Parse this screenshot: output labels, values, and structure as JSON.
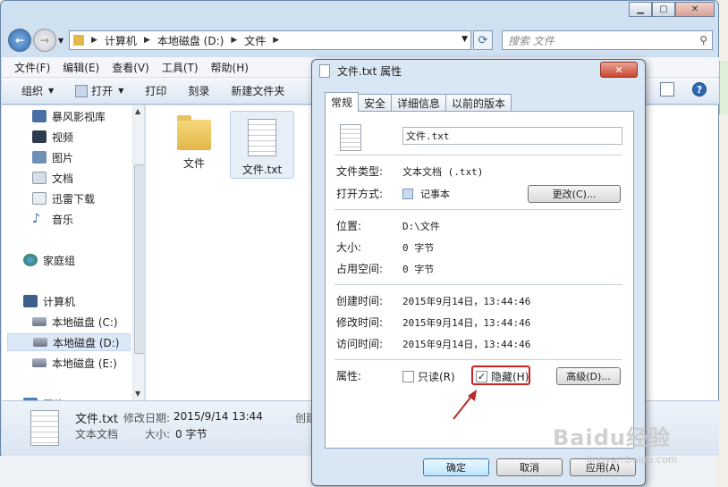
{
  "explorer": {
    "breadcrumbs": [
      "计算机",
      "本地磁盘 (D:)",
      "文件"
    ],
    "search_placeholder": "搜索 文件",
    "menu": [
      "文件(F)",
      "编辑(E)",
      "查看(V)",
      "工具(T)",
      "帮助(H)"
    ],
    "toolbar": {
      "organize": "组织",
      "open": "打开",
      "print": "打印",
      "burn": "刻录",
      "new_folder": "新建文件夹"
    },
    "nav": {
      "youku": "暴风影视库",
      "videos": "视频",
      "pictures": "图片",
      "documents": "文档",
      "thunder": "迅雷下载",
      "music": "音乐",
      "homegroup": "家庭组",
      "computer": "计算机",
      "drive_c": "本地磁盘 (C:)",
      "drive_d": "本地磁盘 (D:)",
      "drive_e": "本地磁盘 (E:)",
      "network": "网络"
    },
    "files": [
      {
        "name": "文件"
      },
      {
        "name": "文件.txt"
      }
    ],
    "details": {
      "name": "文件.txt",
      "modified_label": "修改日期:",
      "modified": "2015/9/14 13:44",
      "type": "文本文档",
      "size_label": "大小:",
      "size": "0 字节",
      "created_label": "创建"
    }
  },
  "dialog": {
    "title": "文件.txt 属性",
    "tabs": [
      "常规",
      "安全",
      "详细信息",
      "以前的版本"
    ],
    "filename": "文件.txt",
    "rows": {
      "type_label": "文件类型:",
      "type_value": "文本文档 (.txt)",
      "open_label": "打开方式:",
      "open_value": "记事本",
      "change_button": "更改(C)...",
      "location_label": "位置:",
      "location_value": "D:\\文件",
      "size_label": "大小:",
      "size_value": "0 字节",
      "disk_label": "占用空间:",
      "disk_value": "0 字节",
      "created_label": "创建时间:",
      "created_value": "2015年9月14日，13:44:46",
      "modified_label": "修改时间:",
      "modified_value": "2015年9月14日，13:44:46",
      "accessed_label": "访问时间:",
      "accessed_value": "2015年9月14日，13:44:46",
      "attr_label": "属性:",
      "readonly": "只读(R)",
      "hidden": "隐藏(H)",
      "advanced_button": "高级(D)..."
    },
    "checks": {
      "readonly": false,
      "hidden": true
    },
    "ok": "确定",
    "cancel": "取消",
    "apply": "应用(A)"
  },
  "watermark": {
    "brand": "Baidu经验",
    "url": "jingyan.baidu.com"
  },
  "colors": {
    "highlight_box": "#cc2323"
  }
}
